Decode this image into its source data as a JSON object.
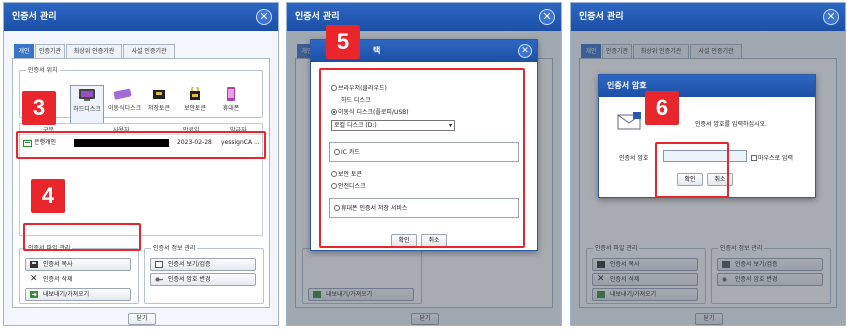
{
  "window_title": "인증서 관리",
  "close_glyph": "✕",
  "tabs": [
    "개인",
    "인증기관",
    "최상위 인증기관",
    "사설 인증기관"
  ],
  "location": {
    "legend": "인증서 위치",
    "items": [
      {
        "label": "하드디스크",
        "icon": "hard-disk-icon"
      },
      {
        "label": "이동식디스크",
        "icon": "removable-disk-icon"
      },
      {
        "label": "저장토큰",
        "icon": "storage-token-icon"
      },
      {
        "label": "보안토큰",
        "icon": "security-token-icon"
      },
      {
        "label": "휴대폰",
        "icon": "mobile-phone-icon"
      }
    ]
  },
  "cert_table": {
    "columns": [
      "구분",
      "사용자",
      "만료일",
      "발급자"
    ],
    "row": {
      "type": "은행개인",
      "user": "",
      "expiry": "2023-02-28",
      "issuer": "yessignCA ..."
    }
  },
  "file_mgmt": {
    "legend": "인증서 파일 관리",
    "copy": "인증서 복사",
    "delete": "인증서 삭제",
    "export": "내보내기/가져오기"
  },
  "info_mgmt": {
    "legend": "인증서 정보 관리",
    "view": "인증서 보기/검증",
    "change_pw": "인증서 암호 변경"
  },
  "close_button": "닫기",
  "markers": [
    "3",
    "4",
    "5",
    "6"
  ],
  "storage_dialog": {
    "title_suffix": "택",
    "opt_browser": "브라우저(클라우드)",
    "opt_hdd": "하드 디스크",
    "opt_usb": "이동식 디스크(플로피/USB)",
    "drive_select": "로컬 디스크 (D:)",
    "opt_ic": "IC 카드",
    "opt_token": "보안 토큰",
    "opt_safe": "안전디스크",
    "opt_mobile": "휴대폰 인증서 저장 서비스",
    "ok": "확인",
    "cancel": "취소"
  },
  "password_dialog": {
    "title": "인증서 암호",
    "message": "인증서 암호를 입력하십시오.",
    "field_label": "인증서 암호",
    "password_value": "",
    "mouse_input": "마우스로 입력",
    "ok": "확인",
    "cancel": "취소"
  },
  "colors": {
    "accent": "#1d4fa6",
    "highlight": "#e8262c"
  }
}
